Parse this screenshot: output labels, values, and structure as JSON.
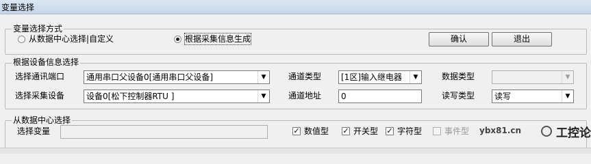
{
  "window": {
    "title": "变量选择"
  },
  "method_group": {
    "legend": "变量选择方式",
    "radio_center": {
      "label": "从数据中心选择|自定义",
      "selected": false
    },
    "radio_collect": {
      "label": "根据采集信息生成",
      "selected": true
    },
    "ok_button": "确认",
    "exit_button": "退出"
  },
  "device_group": {
    "legend": "根据设备信息选择",
    "port_label": "选择通讯端口",
    "port_value": "通用串口父设备0[通用串口父设备]",
    "device_label": "选择采集设备",
    "device_value": "设备0[松下控制器RTU ]",
    "channel_type_label": "通道类型",
    "channel_type_value": "[1区]输入继电器",
    "channel_addr_label": "通道地址",
    "channel_addr_value": "0",
    "data_type_label": "数据类型",
    "data_type_value": "",
    "rw_type_label": "读写类型",
    "rw_type_value": "读写"
  },
  "datacenter_group": {
    "legend": "从数据中心选择",
    "select_var_label": "选择变量",
    "select_var_value": "",
    "filters": [
      {
        "label": "数值型",
        "checked": true,
        "enabled": true
      },
      {
        "label": "开关型",
        "checked": true,
        "enabled": true
      },
      {
        "label": "字符型",
        "checked": true,
        "enabled": true
      },
      {
        "label": "事件型",
        "checked": false,
        "enabled": false
      }
    ]
  },
  "watermark": {
    "site": "ybx81.cn",
    "brand": "工控论坛"
  }
}
